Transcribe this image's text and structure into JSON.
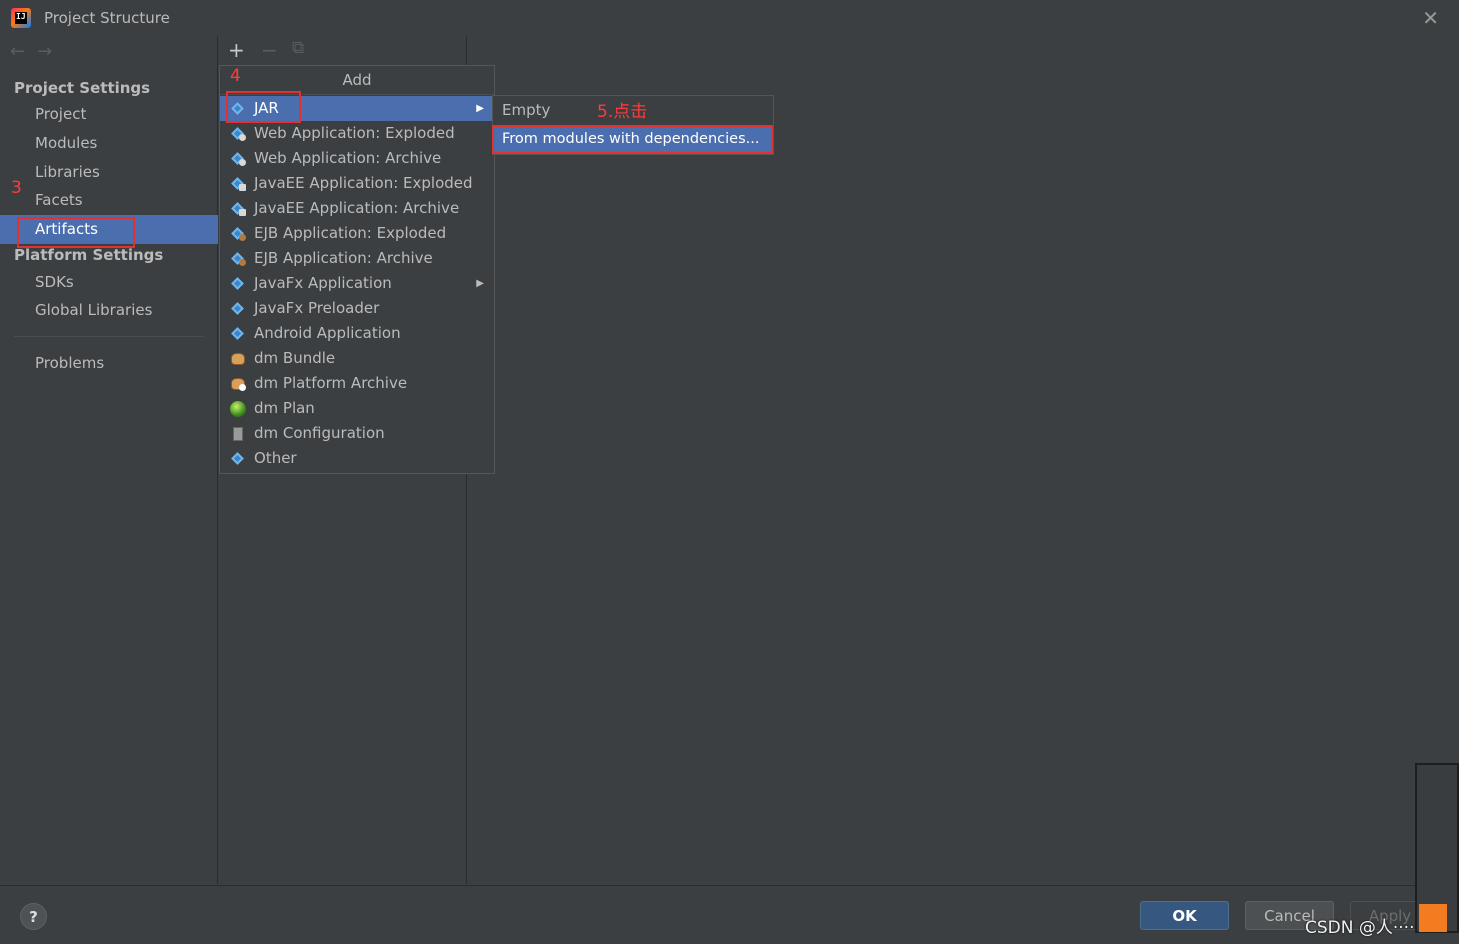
{
  "window": {
    "title": "Project Structure"
  },
  "nav": {
    "back": "←",
    "forward": "→"
  },
  "sidebar": {
    "project_settings_heading": "Project Settings",
    "project_items": [
      "Project",
      "Modules",
      "Libraries",
      "Facets",
      "Artifacts"
    ],
    "selected": "Artifacts",
    "platform_settings_heading": "Platform Settings",
    "platform_items": [
      "SDKs",
      "Global Libraries"
    ],
    "problems": "Problems"
  },
  "toolbar": {
    "add": "+",
    "remove": "−",
    "copy": "⧉"
  },
  "add_menu": {
    "title": "Add",
    "items": [
      {
        "label": "JAR",
        "icon": "jar-diamond-icon",
        "submenu": true,
        "selected": true
      },
      {
        "label": "Web Application: Exploded",
        "icon": "web-app-icon"
      },
      {
        "label": "Web Application: Archive",
        "icon": "web-app-icon"
      },
      {
        "label": "JavaEE Application: Exploded",
        "icon": "javaee-icon"
      },
      {
        "label": "JavaEE Application: Archive",
        "icon": "javaee-icon"
      },
      {
        "label": "EJB Application: Exploded",
        "icon": "ejb-icon"
      },
      {
        "label": "EJB Application: Archive",
        "icon": "ejb-icon"
      },
      {
        "label": "JavaFx Application",
        "icon": "javafx-icon",
        "submenu": true
      },
      {
        "label": "JavaFx Preloader",
        "icon": "javafx-icon"
      },
      {
        "label": "Android Application",
        "icon": "android-icon"
      },
      {
        "label": "dm Bundle",
        "icon": "dm-bundle-icon"
      },
      {
        "label": "dm Platform Archive",
        "icon": "dm-archive-icon"
      },
      {
        "label": "dm Plan",
        "icon": "dm-plan-globe-icon"
      },
      {
        "label": "dm Configuration",
        "icon": "dm-config-doc-icon"
      },
      {
        "label": "Other",
        "icon": "other-diamond-icon"
      }
    ]
  },
  "jar_submenu": {
    "items": [
      "Empty",
      "From modules with dependencies..."
    ],
    "selected": "From modules with dependencies..."
  },
  "annotations": {
    "step3": "3",
    "step4": "4",
    "step5": "5.点击"
  },
  "footer": {
    "help": "?",
    "ok": "OK",
    "cancel": "Cancel",
    "apply": "Apply",
    "watermark": "CSDN @人·····"
  },
  "colors": {
    "selection": "#4b6eaf",
    "background": "#3c3f41",
    "annotation_red": "#e33131",
    "ok_button": "#365880"
  }
}
